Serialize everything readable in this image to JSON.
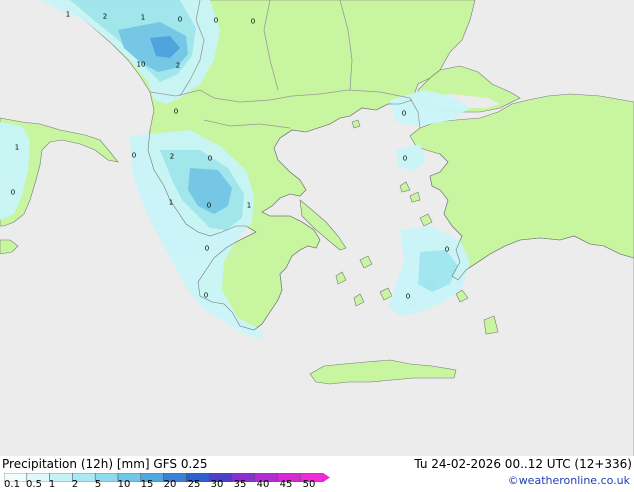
{
  "map": {
    "colors": {
      "sea": "#ececec",
      "land": "#c8f5a0",
      "border": "#9a9a9a",
      "coast": "#777777",
      "precip_light": "#c9f5f9",
      "precip_mid": "#9fe6f0",
      "precip_heavy": "#72c4ea",
      "precip_max": "#4a9fe0"
    },
    "values": [
      "1",
      "2",
      "1",
      "0",
      "0",
      "0",
      "10",
      "2",
      "0",
      "1",
      "2",
      "0",
      "0",
      "0",
      "0",
      "1",
      "0",
      "1",
      "0",
      "0",
      "0",
      "0",
      "0"
    ]
  },
  "footer": {
    "title": "Precipitation (12h) [mm] GFS 0.25",
    "run": "Tu 24-02-2026 00..12 UTC (12+336)",
    "credit": "©weatheronline.co.uk",
    "scale_labels": [
      "0.1",
      "0.5",
      "1",
      "2",
      "5",
      "10",
      "15",
      "20",
      "25",
      "30",
      "35",
      "40",
      "45",
      "50"
    ],
    "scale_colors": [
      "#f2fdfd",
      "#dff8fb",
      "#c5f2f7",
      "#a9e9f3",
      "#8cdcee",
      "#6fc7ea",
      "#4fa8e2",
      "#3a82d8",
      "#2f5fcf",
      "#4b3fcb",
      "#8a2fd0",
      "#b12cd2",
      "#d42ad4",
      "#f02ad8"
    ]
  }
}
